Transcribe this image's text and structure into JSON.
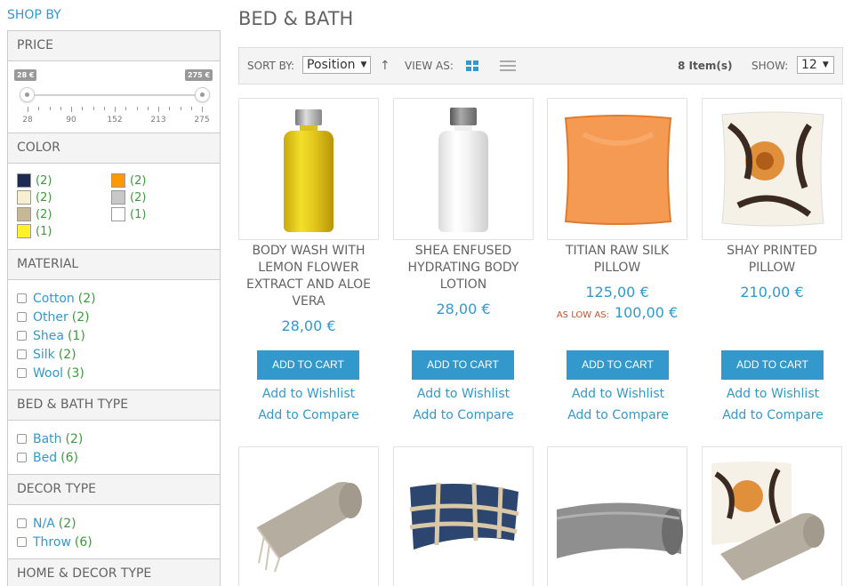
{
  "sidebar": {
    "shop_by": "SHOP BY",
    "price": {
      "title": "PRICE",
      "min_tag": "28 €",
      "max_tag": "275 €",
      "range": [
        28,
        275
      ],
      "tick_labels": [
        "28",
        "90",
        "152",
        "213",
        "275"
      ]
    },
    "color": {
      "title": "COLOR",
      "items": [
        {
          "color": "#1e2a52",
          "count": "(2)"
        },
        {
          "color": "#ff9900",
          "count": "(2)"
        },
        {
          "color": "#f7efcf",
          "count": "(2)"
        },
        {
          "color": "#c8c8c8",
          "count": "(2)"
        },
        {
          "color": "#c6b797",
          "count": "(2)"
        },
        {
          "color": "#ffffff",
          "count": "(1)"
        },
        {
          "color": "#fff12a",
          "count": "(1)"
        }
      ]
    },
    "material": {
      "title": "MATERIAL",
      "items": [
        {
          "label": "Cotton",
          "count": "(2)"
        },
        {
          "label": "Other",
          "count": "(2)"
        },
        {
          "label": "Shea",
          "count": "(1)"
        },
        {
          "label": "Silk",
          "count": "(2)"
        },
        {
          "label": "Wool",
          "count": "(3)"
        }
      ]
    },
    "bed_bath_type": {
      "title": "BED & BATH TYPE",
      "items": [
        {
          "label": "Bath",
          "count": "(2)"
        },
        {
          "label": "Bed",
          "count": "(6)"
        }
      ]
    },
    "decor_type": {
      "title": "DECOR TYPE",
      "items": [
        {
          "label": "N/A",
          "count": "(2)"
        },
        {
          "label": "Throw",
          "count": "(6)"
        }
      ]
    },
    "home_decor_type": {
      "title": "HOME & DECOR TYPE"
    }
  },
  "main": {
    "title": "BED & BATH",
    "toolbar": {
      "sort_label": "SORT BY:",
      "sort_value": "Position",
      "view_label": "VIEW AS:",
      "item_count": "8 Item(s)",
      "show_label": "SHOW:",
      "show_value": "12"
    },
    "products": [
      {
        "name": "BODY WASH WITH LEMON FLOWER EXTRACT AND ALOE VERA",
        "price": "28,00 €",
        "cart": "ADD TO CART",
        "wishlist": "Add to Wishlist",
        "compare": "Add to Compare"
      },
      {
        "name": "SHEA ENFUSED HYDRATING BODY LOTION",
        "price": "28,00 €",
        "cart": "ADD TO CART",
        "wishlist": "Add to Wishlist",
        "compare": "Add to Compare"
      },
      {
        "name": "TITIAN RAW SILK PILLOW",
        "price": "125,00 €",
        "low_label": "AS LOW AS:",
        "low_price": "100,00 €",
        "cart": "ADD TO CART",
        "wishlist": "Add to Wishlist",
        "compare": "Add to Compare"
      },
      {
        "name": "SHAY PRINTED PILLOW",
        "price": "210,00 €",
        "cart": "ADD TO CART",
        "wishlist": "Add to Wishlist",
        "compare": "Add to Compare"
      }
    ]
  }
}
